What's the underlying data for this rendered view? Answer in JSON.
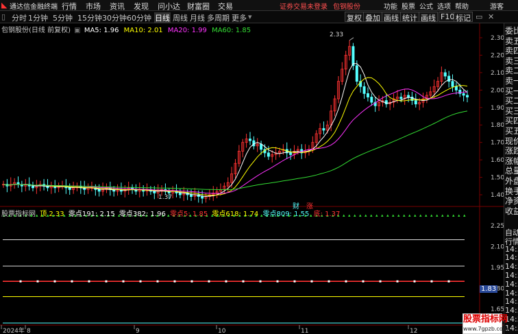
{
  "menubar": {
    "app_title": "通达信金融终端",
    "items": [
      "行情",
      "市场",
      "资讯",
      "发现",
      "问小达",
      "财富圈",
      "交易"
    ],
    "notice": "证券交易未登录",
    "stock": "包钢股份",
    "right_items": [
      "功能",
      "股票",
      "公式",
      "选项",
      "帮助"
    ],
    "user": "游客"
  },
  "toolbar": {
    "periods": [
      "分时",
      "1分钟",
      "5分钟",
      "15分钟",
      "30分钟",
      "60分钟",
      "日线",
      "周线",
      "月线",
      "多周期",
      "更多"
    ],
    "active": "日线",
    "right_buttons": [
      "复权",
      "叠加",
      "画线",
      "统计",
      "画线",
      "F10",
      "标记"
    ]
  },
  "main_chart": {
    "stock_label": "包钢股份(日线 前复权)",
    "ma_items": [
      {
        "label": "MA5: 1.96",
        "color": "#ffffff"
      },
      {
        "label": "MA10: 2.01",
        "color": "#ffff00"
      },
      {
        "label": "MA20: 1.99",
        "color": "#ff33ff"
      },
      {
        "label": "MA60: 1.85",
        "color": "#33dd33"
      }
    ],
    "y_ticks": [
      "2.30",
      "2.20",
      "2.10",
      "2.00",
      "1.90",
      "1.80",
      "1.70",
      "1.60",
      "1.50",
      "1.40"
    ],
    "high_label": "2.33",
    "low_label": "1.37",
    "event_labels": [
      "财",
      "涨"
    ],
    "colors": {
      "up": "#ff3232",
      "down": "#54ffff",
      "ma5": "#ffffff",
      "ma10": "#ffff00",
      "ma20": "#ff33ff",
      "ma60": "#33dd33",
      "grid": "#7a0000"
    }
  },
  "indicator": {
    "title": "股票指标网",
    "items": [
      {
        "label": "顶 2.33",
        "color": "#ffff00"
      },
      {
        "label": "零点191: 2.15",
        "color": "#ffffff"
      },
      {
        "label": "零点382: 1.96",
        "color": "#ffffff"
      },
      {
        "label": "零点5: 1.85",
        "color": "#ff3232"
      },
      {
        "label": "零点618: 1.74",
        "color": "#ffff00"
      },
      {
        "label": "零点809: 1.55",
        "color": "#54ffff"
      },
      {
        "label": "底: 1.37",
        "color": "#ff3232"
      }
    ],
    "y_ticks": [
      "2.25",
      "2.10",
      "1.95",
      "1.80",
      "1.65"
    ],
    "current_value": "1.83"
  },
  "x_axis": {
    "labels": [
      "2024年",
      "8",
      "9",
      "10",
      "11",
      "12"
    ]
  },
  "sidebar": {
    "top_items": [
      "委比",
      "卖五",
      "卖四",
      "卖三",
      "卖二",
      "卖一",
      "买一",
      "买二",
      "买三",
      "买四",
      "买五",
      "现价",
      "涨跌",
      "涨幅",
      "总量",
      "外盘",
      "换手",
      "净资",
      "收益"
    ],
    "bottom_items": [
      "自动",
      "行情",
      "14:5",
      "14:5",
      "14:5",
      "14:5",
      "14:5",
      "14:5",
      "14:5",
      "14:5",
      "14:5",
      "14:5",
      "14:5"
    ]
  },
  "watermark": {
    "title": "股票指标网",
    "url": "www.7gpzb.com"
  }
}
